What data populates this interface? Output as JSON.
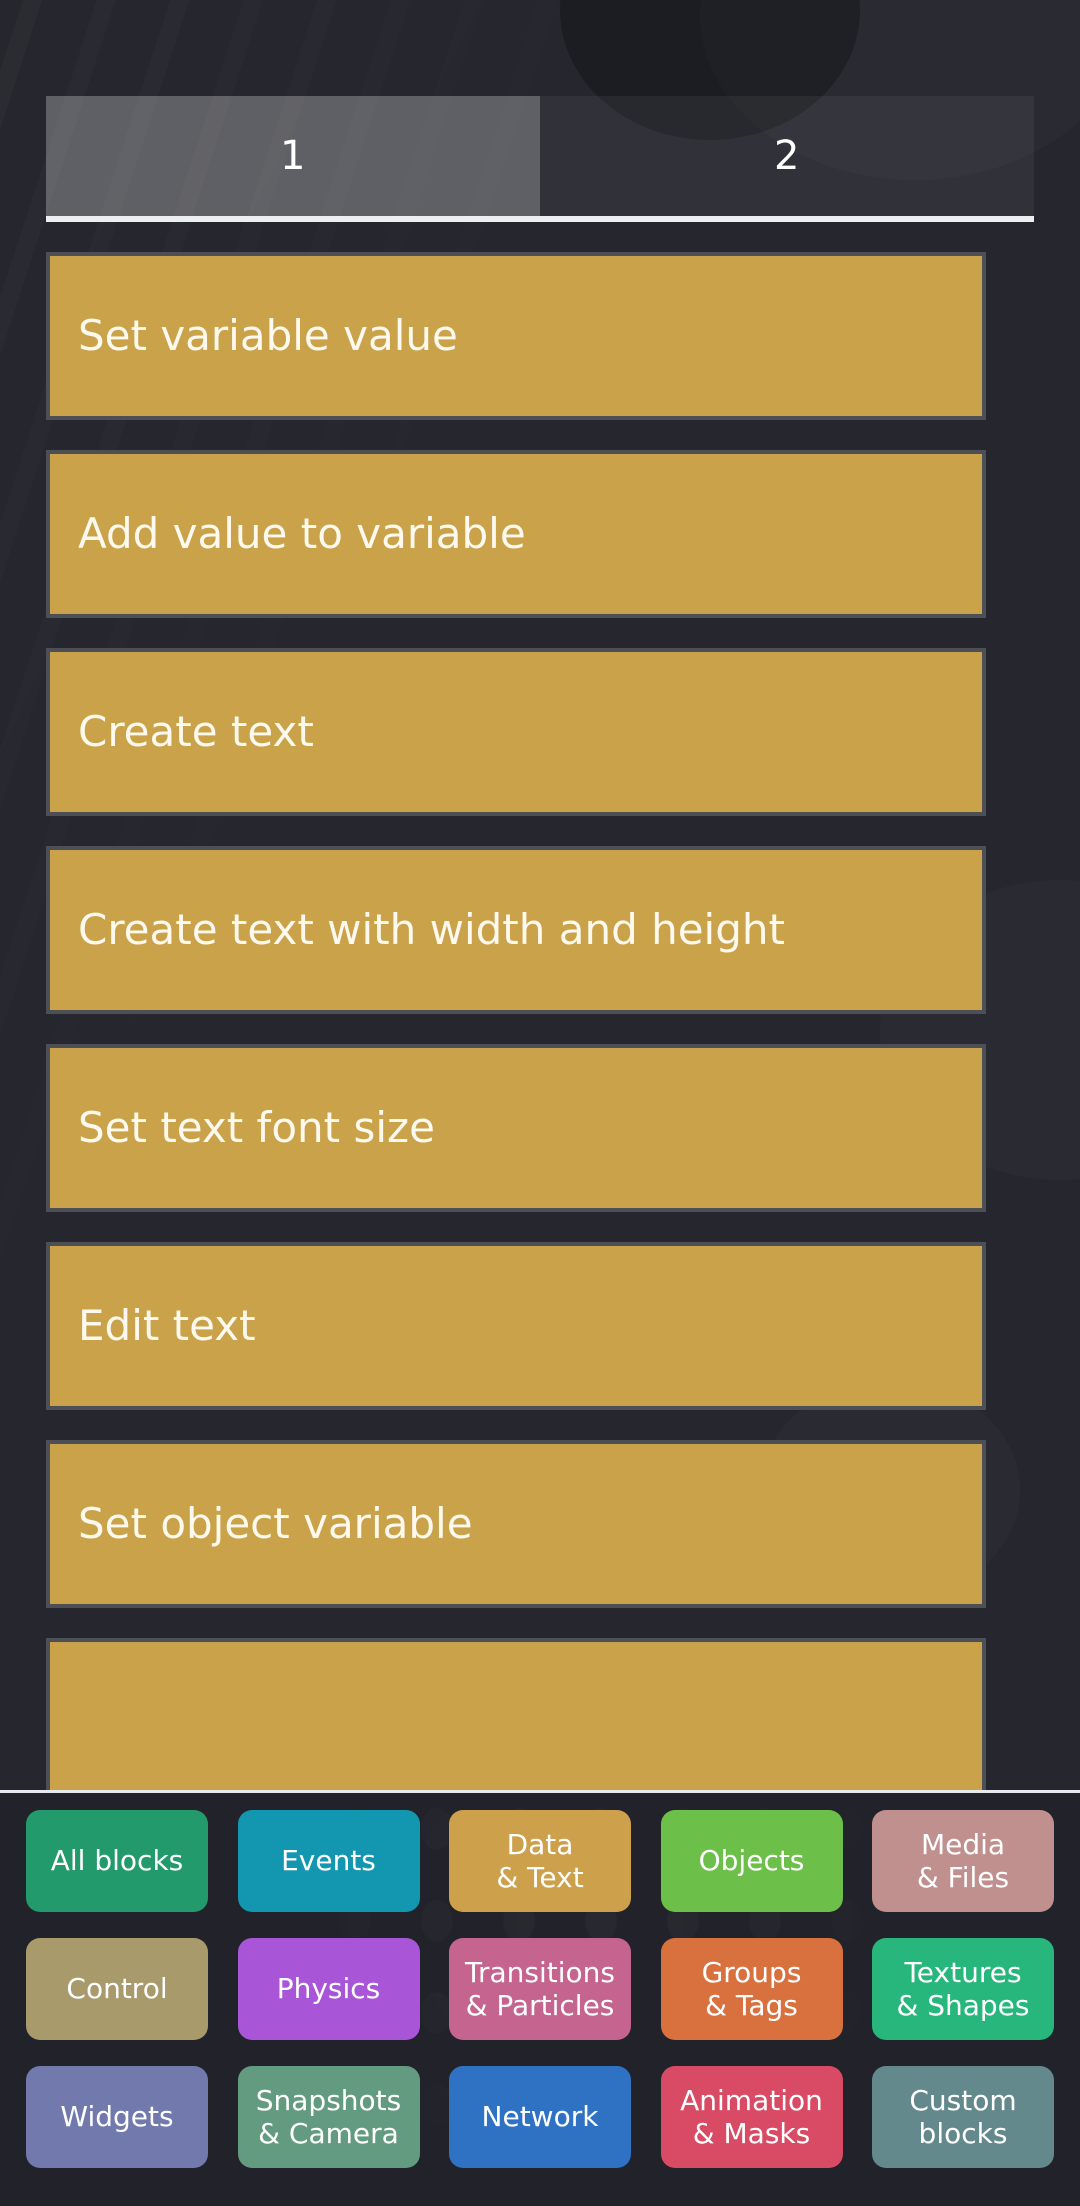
{
  "theme": {
    "background": "#26272e",
    "panel_background": "#22232a",
    "block_fill": "#c9a24a",
    "block_border": "#4d4f56",
    "separator": "#e8eaec",
    "text": "#ffffff"
  },
  "tabs": {
    "items": [
      {
        "label": "1",
        "selected": true
      },
      {
        "label": "2",
        "selected": false
      }
    ]
  },
  "blocks": {
    "items": [
      {
        "label": "Set variable value"
      },
      {
        "label": "Add value to variable"
      },
      {
        "label": "Create text"
      },
      {
        "label": "Create text with width and height"
      },
      {
        "label": "Set text font size"
      },
      {
        "label": "Edit text"
      },
      {
        "label": "Set object variable"
      },
      {
        "label": ""
      }
    ]
  },
  "categories": {
    "rows": [
      [
        {
          "label": "All blocks",
          "color": "#229a6b"
        },
        {
          "label": "Events",
          "color": "#1397b0"
        },
        {
          "label": "Data\n& Text",
          "color": "#cda04c"
        },
        {
          "label": "Objects",
          "color": "#6cc04a"
        },
        {
          "label": "Media\n& Files",
          "color": "#c0908f"
        }
      ],
      [
        {
          "label": "Control",
          "color": "#a89a6b"
        },
        {
          "label": "Physics",
          "color": "#a855d8"
        },
        {
          "label": "Transitions\n& Particles",
          "color": "#c4648f"
        },
        {
          "label": "Groups\n& Tags",
          "color": "#d9713f"
        },
        {
          "label": "Textures\n& Shapes",
          "color": "#27b77c"
        }
      ],
      [
        {
          "label": "Widgets",
          "color": "#7179ad"
        },
        {
          "label": "Snapshots\n& Camera",
          "color": "#639b80"
        },
        {
          "label": "Network",
          "color": "#2f72c4"
        },
        {
          "label": "Animation\n& Masks",
          "color": "#d94a64"
        },
        {
          "label": "Custom\nblocks",
          "color": "#63898c"
        }
      ]
    ]
  }
}
